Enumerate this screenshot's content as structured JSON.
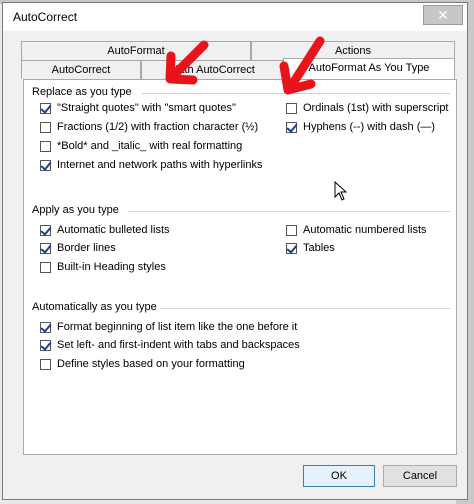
{
  "window": {
    "title": "AutoCorrect",
    "close_glyph": "✕"
  },
  "tabs_back": [
    {
      "label": "AutoFormat"
    },
    {
      "label": "Actions"
    }
  ],
  "tabs_front": [
    {
      "label": "AutoCorrect"
    },
    {
      "label": "Math AutoCorrect"
    },
    {
      "label": "AutoFormat As You Type",
      "active": true
    }
  ],
  "groups": {
    "replace": {
      "title": "Replace as you type",
      "items": [
        {
          "label": "\"Straight quotes\" with \"smart quotes\"",
          "checked": true
        },
        {
          "label": "Fractions (1/2) with fraction character (½)",
          "checked": false
        },
        {
          "label": "*Bold* and _italic_ with real formatting",
          "checked": false
        },
        {
          "label": "Internet and network paths with hyperlinks",
          "checked": true
        },
        {
          "label": "Ordinals (1st) with superscript",
          "checked": false
        },
        {
          "label": "Hyphens (--) with dash (—)",
          "checked": true
        }
      ]
    },
    "apply": {
      "title": "Apply as you type",
      "items": [
        {
          "label": "Automatic bulleted lists",
          "checked": true
        },
        {
          "label": "Border lines",
          "checked": true
        },
        {
          "label": "Built-in Heading styles",
          "checked": false
        },
        {
          "label": "Automatic numbered lists",
          "checked": false
        },
        {
          "label": "Tables",
          "checked": true
        }
      ]
    },
    "auto": {
      "title": "Automatically as you type",
      "items": [
        {
          "label": "Format beginning of list item like the one before it",
          "checked": true
        },
        {
          "label": "Set left- and first-indent with tabs and backspaces",
          "checked": true
        },
        {
          "label": "Define styles based on your formatting",
          "checked": false
        }
      ]
    }
  },
  "buttons": {
    "ok": "OK",
    "cancel": "Cancel"
  },
  "colors": {
    "arrow": "#e8141c",
    "accent": "#3c7fb1",
    "check": "#1a3f8c"
  }
}
